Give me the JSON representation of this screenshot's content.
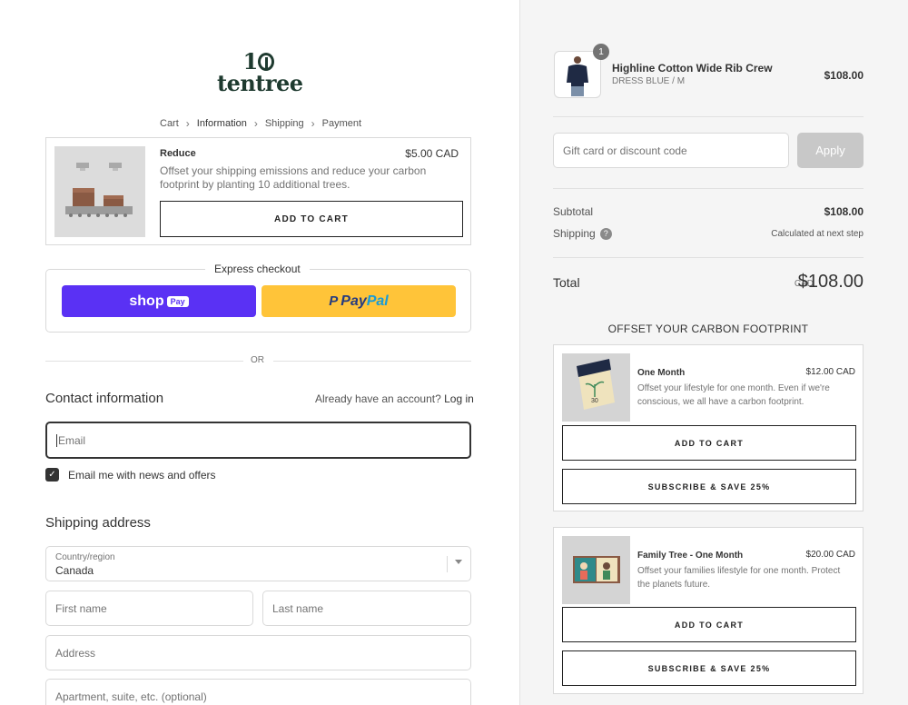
{
  "brand": {
    "logo_number": "10",
    "logo_word": "tentree"
  },
  "breadcrumb": [
    "Cart",
    "Information",
    "Shipping",
    "Payment"
  ],
  "reduce": {
    "title": "Reduce",
    "price": "$5.00 CAD",
    "description": "Offset your shipping emissions and reduce your carbon footprint by planting 10 additional trees.",
    "button": "ADD TO CART"
  },
  "express": {
    "label": "Express checkout",
    "shop_text": "shop",
    "shop_pay": "Pay",
    "paypal_a": "Pay",
    "paypal_b": "Pal"
  },
  "or_label": "OR",
  "contact": {
    "heading": "Contact information",
    "login_prompt": "Already have an account?",
    "login_link": "Log in",
    "email_placeholder": "Email",
    "newsletter_label": "Email me with news and offers",
    "newsletter_checked": true
  },
  "shipping": {
    "heading": "Shipping address",
    "country_label": "Country/region",
    "country_value": "Canada",
    "first_name": "First name",
    "last_name": "Last name",
    "address": "Address",
    "apartment": "Apartment, suite, etc. (optional)"
  },
  "order": {
    "quantity": "1",
    "product_name": "Highline Cotton Wide Rib Crew",
    "variant": "DRESS BLUE / M",
    "price": "$108.00",
    "discount_placeholder": "Gift card or discount code",
    "apply_label": "Apply",
    "subtotal_label": "Subtotal",
    "subtotal_value": "$108.00",
    "shipping_label": "Shipping",
    "shipping_value": "Calculated at next step",
    "total_label": "Total",
    "currency": "CAD",
    "total_value": "$108.00"
  },
  "offset": {
    "heading": "OFFSET YOUR CARBON FOOTPRINT",
    "cards": [
      {
        "title": "One Month",
        "price": "$12.00 CAD",
        "description": "Offset your lifestyle for one month. Even if we're conscious, we all have a carbon footprint.",
        "add_button": "ADD TO CART",
        "subscribe_button": "SUBSCRIBE & SAVE 25%",
        "image_text": "30"
      },
      {
        "title": "Family Tree - One Month",
        "price": "$20.00 CAD",
        "description": "Offset your families lifestyle for one month. Protect the planets future.",
        "add_button": "ADD TO CART",
        "subscribe_button": "SUBSCRIBE & SAVE 25%"
      }
    ]
  },
  "colors": {
    "shop_pay": "#5a31f4",
    "paypal": "#ffc439",
    "brand_green": "#1e3a2f",
    "apply_disabled": "#c8c8c8"
  }
}
